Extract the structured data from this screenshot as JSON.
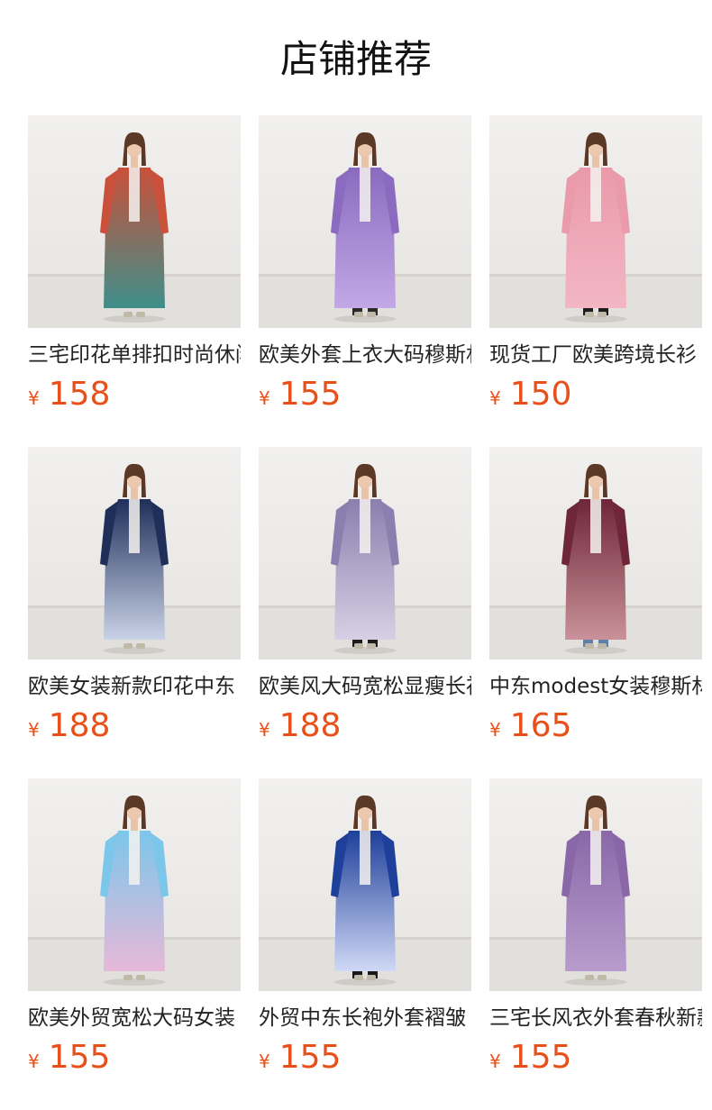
{
  "header": {
    "title": "店铺推荐"
  },
  "currency_symbol": "¥",
  "colors": {
    "price": "#e8501a",
    "title": "#111111",
    "name": "#222222",
    "background": "#ffffff"
  },
  "products": [
    {
      "name": "三宅印花单排扣时尚休闲",
      "price": "158",
      "image": "product-photo-floral-print-coat",
      "dress": "#c9503a",
      "accent": "#3f8f8a",
      "pants": ""
    },
    {
      "name": "欧美外套上衣大码穆斯林",
      "price": "155",
      "image": "product-photo-purple-gradient-coat",
      "dress": "#8a6bbf",
      "accent": "#c2a8e6",
      "pants": "#2b2b2b"
    },
    {
      "name": "现货工厂欧美跨境长衫",
      "price": "150",
      "image": "product-photo-pink-coat",
      "dress": "#e99aab",
      "accent": "#f3b6c3",
      "pants": "#1d1d1d"
    },
    {
      "name": "欧美女装新款印花中东",
      "price": "188",
      "image": "product-photo-navy-print-robe",
      "dress": "#1f2f5a",
      "accent": "#c9d2e6",
      "pants": ""
    },
    {
      "name": "欧美风大码宽松显瘦长衫",
      "price": "188",
      "image": "product-photo-paisley-print-coat",
      "dress": "#8a7fae",
      "accent": "#d7d0e4",
      "pants": "#1c1c1c"
    },
    {
      "name": "中东modest女装穆斯林",
      "price": "165",
      "image": "product-photo-burgundy-gradient-coat",
      "dress": "#6e2638",
      "accent": "#c9929a",
      "pants": "#5d7fa8"
    },
    {
      "name": "欧美外贸宽松大码女装",
      "price": "155",
      "image": "product-photo-sky-blue-coat",
      "dress": "#7cc6ea",
      "accent": "#e7b8d8",
      "pants": ""
    },
    {
      "name": "外贸中东长袍外套褶皱",
      "price": "155",
      "image": "product-photo-royal-blue-coat",
      "dress": "#1e3f9a",
      "accent": "#cfd8f5",
      "pants": "#1a1a1a"
    },
    {
      "name": "三宅长风衣外套春秋新款",
      "price": "155",
      "image": "product-photo-lavender-long-coat",
      "dress": "#8a68a8",
      "accent": "#b79ccc",
      "pants": ""
    }
  ]
}
